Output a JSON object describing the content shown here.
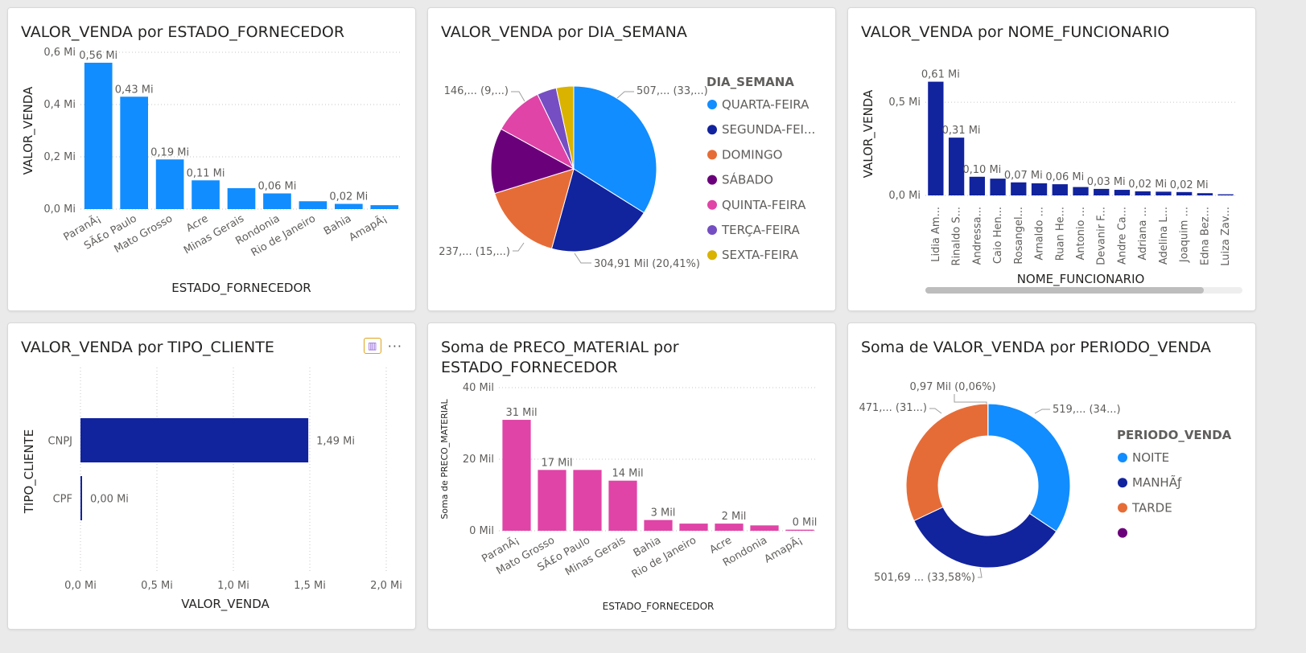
{
  "colors": {
    "blue": "#118DFF",
    "navy": "#12239E",
    "orange": "#E66C37",
    "purple": "#6B007B",
    "pink": "#E044A7",
    "violet": "#744EC2",
    "gold": "#D9B300",
    "gray_text": "#605E5C"
  },
  "chart_data": [
    {
      "id": "c1",
      "type": "bar",
      "title": "VALOR_VENDA por ESTADO_FORNECEDOR",
      "xlabel": "ESTADO_FORNECEDOR",
      "ylabel": "VALOR_VENDA",
      "ylim": [
        0,
        0.6
      ],
      "yticks": [
        "0,0 Mi",
        "0,2 Mi",
        "0,4 Mi",
        "0,6 Mi"
      ],
      "grid": true,
      "categories": [
        "ParanÃ¡",
        "SÃ£o Paulo",
        "Mato Grosso",
        "Acre",
        "Minas Gerais",
        "Rondonia",
        "Rio de Janeiro",
        "Bahia",
        "AmapÃ¡"
      ],
      "values": [
        0.56,
        0.43,
        0.19,
        0.11,
        0.08,
        0.06,
        0.03,
        0.02,
        0.015
      ],
      "labels": [
        "0,56 Mi",
        "0,43 Mi",
        "0,19 Mi",
        "0,11 Mi",
        "",
        "0,06 Mi",
        "",
        "0,02 Mi",
        ""
      ]
    },
    {
      "id": "c2",
      "type": "pie",
      "title": "VALOR_VENDA por DIA_SEMANA",
      "legend_title": "DIA_SEMANA",
      "legend_placement": "right",
      "categories": [
        "QUARTA-FEIRA",
        "SEGUNDA-FEI...",
        "DOMINGO",
        "SÁBADO",
        "QUINTA-FEIRA",
        "TERÇA-FEIRA",
        "SEXTA-FEIRA"
      ],
      "values": [
        33.9,
        20.41,
        15.9,
        12.8,
        9.8,
        3.8,
        3.4
      ],
      "labels": [
        "507,... (33,...)",
        "304,91 Mil (20,41%)",
        "237,... (15,...)",
        "",
        "146,... (9,...)",
        "",
        ""
      ]
    },
    {
      "id": "c3",
      "type": "bar",
      "title": "VALOR_VENDA por NOME_FUNCIONARIO",
      "xlabel": "NOME_FUNCIONARIO",
      "ylabel": "VALOR_VENDA",
      "ylim": [
        0,
        0.66
      ],
      "yticks": [
        "0,0 Mi",
        "0,5 Mi"
      ],
      "grid": true,
      "categories": [
        "Lidia Am...",
        "Rinaldo S...",
        "Andressa...",
        "Caio Hen...",
        "Rosangel...",
        "Arnaldo ...",
        "Ruan He...",
        "Antonio ...",
        "Devanir F...",
        "Andre Ca...",
        "Adriana ...",
        "Adelina L...",
        "Joaquim ...",
        "Edna Bez...",
        "Luiza Zav..."
      ],
      "values": [
        0.61,
        0.31,
        0.1,
        0.09,
        0.07,
        0.065,
        0.06,
        0.045,
        0.035,
        0.03,
        0.022,
        0.02,
        0.018,
        0.012,
        0.006
      ],
      "labels": [
        "0,61 Mi",
        "0,31 Mi",
        "0,10 Mi",
        "",
        "0,07 Mi",
        "",
        "0,06 Mi",
        "",
        "0,03 Mi",
        "",
        "0,02 Mi",
        "",
        "0,02 Mi",
        "",
        ""
      ]
    },
    {
      "id": "c4",
      "type": "bar",
      "orientation": "horizontal",
      "title": "VALOR_VENDA por TIPO_CLIENTE",
      "xlabel": "VALOR_VENDA",
      "ylabel": "TIPO_CLIENTE",
      "xlim": [
        0,
        2.0
      ],
      "xticks": [
        "0,0 Mi",
        "0,5 Mi",
        "1,0 Mi",
        "1,5 Mi",
        "2,0 Mi"
      ],
      "grid": true,
      "categories": [
        "CNPJ",
        "CPF"
      ],
      "values": [
        1.49,
        0.002
      ],
      "labels": [
        "1,49 Mi",
        "0,00 Mi"
      ]
    },
    {
      "id": "c5",
      "type": "bar",
      "title": "Soma de PRECO_MATERIAL por ESTADO_FORNECEDOR",
      "xlabel": "ESTADO_FORNECEDOR",
      "ylabel": "Soma de PRECO_MATERIAL",
      "ylim": [
        0,
        40
      ],
      "yticks": [
        "0 Mil",
        "20 Mil",
        "40 Mil"
      ],
      "grid": true,
      "categories": [
        "ParanÃ¡",
        "Mato Grosso",
        "SÃ£o Paulo",
        "Minas Gerais",
        "Bahia",
        "Rio de Janeiro",
        "Acre",
        "Rondonia",
        "AmapÃ¡"
      ],
      "values": [
        31,
        17,
        17,
        14,
        3,
        2,
        2,
        1.5,
        0.3
      ],
      "labels": [
        "31 Mil",
        "17 Mil",
        "",
        "14 Mil",
        "3 Mil",
        "",
        "2 Mil",
        "",
        "0 Mil"
      ]
    },
    {
      "id": "c6",
      "type": "pie",
      "donut": true,
      "title": "Soma de VALOR_VENDA por PERIODO_VENDA",
      "legend_title": "PERIODO_VENDA",
      "legend_placement": "right",
      "categories": [
        "NOITE",
        "MANHÃƒ",
        "TARDE",
        ""
      ],
      "values": [
        34.4,
        33.58,
        31.96,
        0.06
      ],
      "labels": [
        "519,... (34...)",
        "501,69 ... (33,58%)",
        "471,... (31...)",
        "0,97 Mil (0,06%)"
      ]
    }
  ]
}
